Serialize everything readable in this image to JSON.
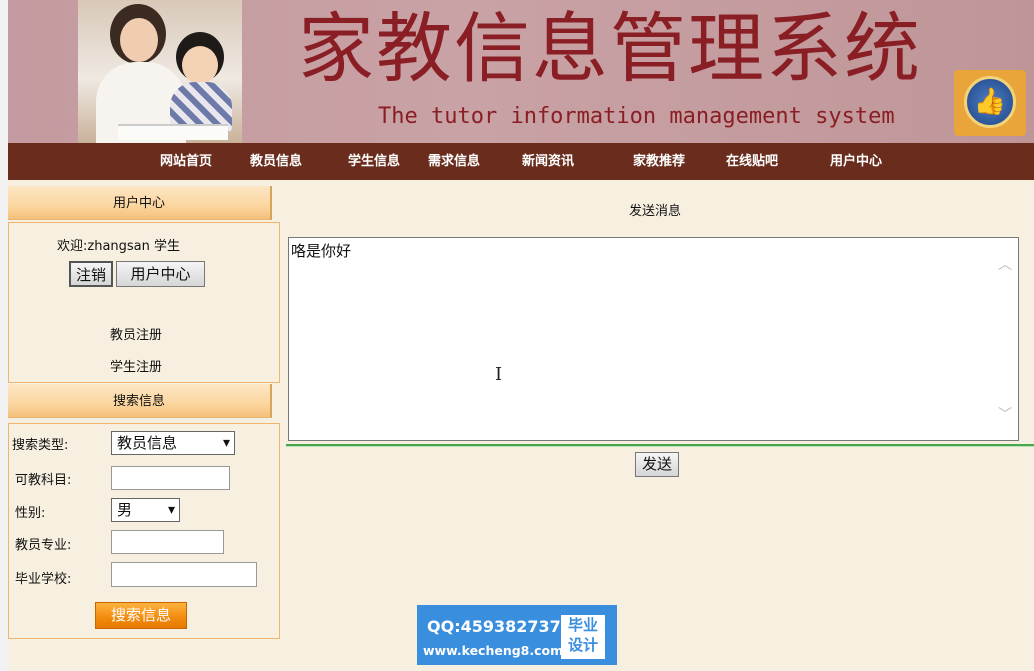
{
  "banner": {
    "title": "家教信息管理系统",
    "subtitle": "The tutor information management system"
  },
  "nav": {
    "items": [
      {
        "label": "网站首页"
      },
      {
        "label": "教员信息"
      },
      {
        "label": "学生信息"
      },
      {
        "label": "需求信息"
      },
      {
        "label": "新闻资讯"
      },
      {
        "label": "家教推荐"
      },
      {
        "label": "在线贴吧"
      },
      {
        "label": "用户中心"
      }
    ]
  },
  "sidebar": {
    "user_center": {
      "header": "用户中心",
      "welcome": "欢迎:zhangsan 学生",
      "logout_label": "注销",
      "user_center_label": "用户中心",
      "teacher_register": "教员注册",
      "student_register": "学生注册"
    },
    "search": {
      "header": "搜索信息",
      "type_label": "搜索类型:",
      "type_value": "教员信息",
      "subject_label": "可教科目:",
      "subject_value": "",
      "gender_label": "性别:",
      "gender_value": "男",
      "major_label": "教员专业:",
      "major_value": "",
      "school_label": "毕业学校:",
      "school_value": "",
      "search_button": "搜索信息"
    }
  },
  "main": {
    "heading": "发送消息",
    "message_text": "咯是你好",
    "send_label": "发送"
  },
  "watermark": {
    "qq": "QQ:459382737",
    "site": "www.kecheng8.com",
    "tag_line1": "毕业",
    "tag_line2": "设计"
  },
  "colors": {
    "nav_bg": "#6a2d1d",
    "title_red": "#8a1e25",
    "page_bg": "#f7f0e0"
  }
}
